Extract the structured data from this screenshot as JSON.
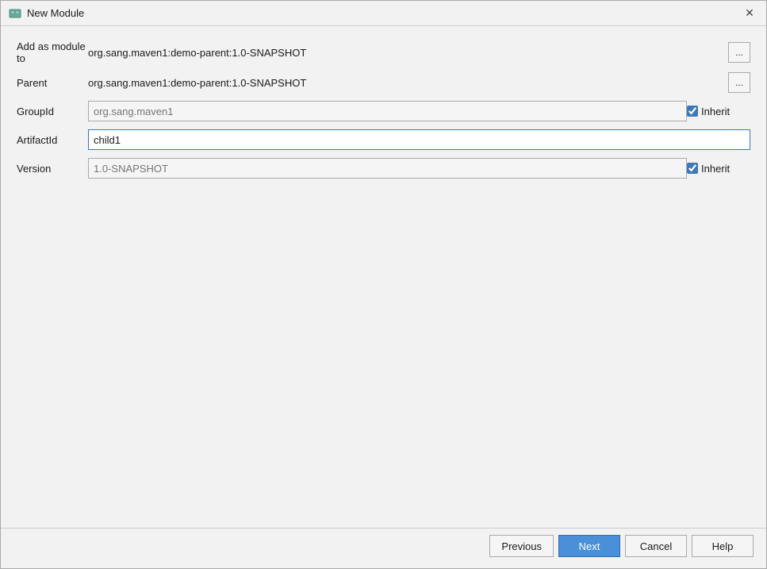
{
  "dialog": {
    "title": "New Module",
    "close_label": "✕"
  },
  "form": {
    "add_as_module_label": "Add as module to",
    "add_as_module_value": "org.sang.maven1:demo-parent:1.0-SNAPSHOT",
    "parent_label": "Parent",
    "parent_value": "org.sang.maven1:demo-parent:1.0-SNAPSHOT",
    "group_id_label": "GroupId",
    "group_id_placeholder": "org.sang.maven1",
    "group_id_inherit": true,
    "artifact_id_label": "ArtifactId",
    "artifact_id_value": "child1",
    "version_label": "Version",
    "version_placeholder": "1.0-SNAPSHOT",
    "version_inherit": true,
    "inherit_label": "Inherit",
    "browse_label": "..."
  },
  "footer": {
    "previous_label": "Previous",
    "next_label": "Next",
    "cancel_label": "Cancel",
    "help_label": "Help"
  }
}
